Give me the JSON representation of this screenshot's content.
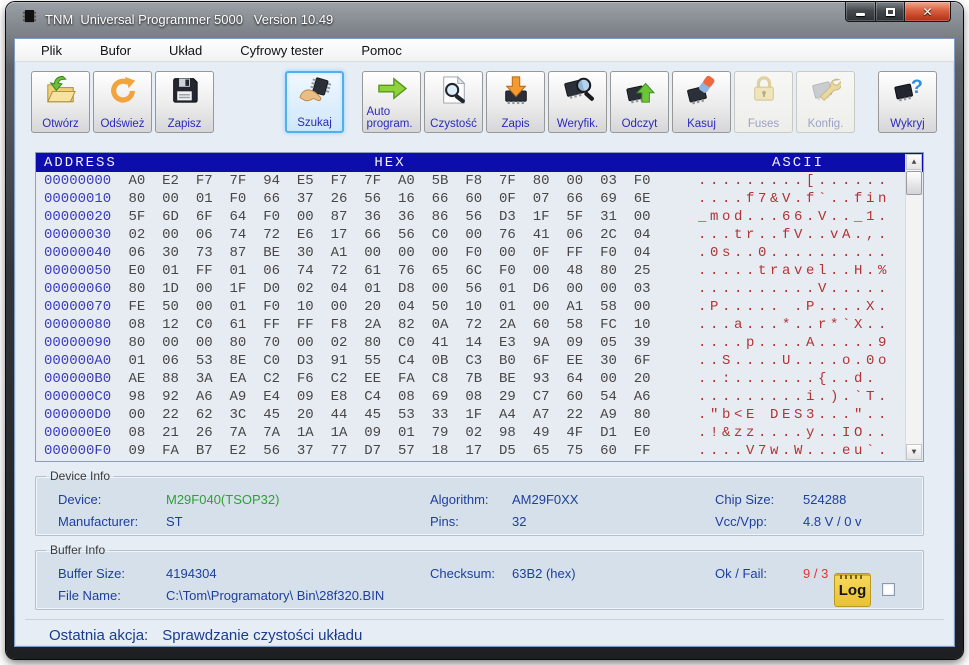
{
  "window": {
    "title": "TNM  Universal Programmer 5000   Version 10.49"
  },
  "menu": {
    "items": [
      "Plik",
      "Bufor",
      "Układ",
      "Cyfrowy tester",
      "Pomoc"
    ]
  },
  "toolbar": {
    "buttons": [
      {
        "label": "Otwórz",
        "state": "normal"
      },
      {
        "label": "Odśwież",
        "state": "normal"
      },
      {
        "label": "Zapisz",
        "state": "normal"
      },
      {
        "label": "Szukaj",
        "state": "active"
      },
      {
        "label": "Auto program.",
        "state": "normal"
      },
      {
        "label": "Czystość",
        "state": "normal"
      },
      {
        "label": "Zapis",
        "state": "normal"
      },
      {
        "label": "Weryfik.",
        "state": "normal"
      },
      {
        "label": "Odczyt",
        "state": "normal"
      },
      {
        "label": "Kasuj",
        "state": "normal"
      },
      {
        "label": "Fuses",
        "state": "disabled"
      },
      {
        "label": "Konfig.",
        "state": "disabled"
      },
      {
        "label": "Wykryj",
        "state": "normal"
      }
    ]
  },
  "hex_view": {
    "headers": {
      "address": "ADDRESS",
      "hex": "HEX",
      "ascii": "ASCII"
    },
    "rows": [
      {
        "address": "00000000",
        "bytes": [
          "A0",
          "E2",
          "F7",
          "7F",
          "94",
          "E5",
          "F7",
          "7F",
          "A0",
          "5B",
          "F8",
          "7F",
          "80",
          "00",
          "03",
          "F0"
        ],
        "ascii": ".........[......"
      },
      {
        "address": "00000010",
        "bytes": [
          "80",
          "00",
          "01",
          "F0",
          "66",
          "37",
          "26",
          "56",
          "16",
          "66",
          "60",
          "0F",
          "07",
          "66",
          "69",
          "6E"
        ],
        "ascii": "....f7&V.f`..fin"
      },
      {
        "address": "00000020",
        "bytes": [
          "5F",
          "6D",
          "6F",
          "64",
          "F0",
          "00",
          "87",
          "36",
          "36",
          "86",
          "56",
          "D3",
          "1F",
          "5F",
          "31",
          "00"
        ],
        "ascii": "_mod...66.V.._1."
      },
      {
        "address": "00000030",
        "bytes": [
          "02",
          "00",
          "06",
          "74",
          "72",
          "E6",
          "17",
          "66",
          "56",
          "C0",
          "00",
          "76",
          "41",
          "06",
          "2C",
          "04"
        ],
        "ascii": "...tr..fV..vA.,."
      },
      {
        "address": "00000040",
        "bytes": [
          "06",
          "30",
          "73",
          "87",
          "BE",
          "30",
          "A1",
          "00",
          "00",
          "00",
          "F0",
          "00",
          "0F",
          "FF",
          "F0",
          "04"
        ],
        "ascii": ".0s..0.........."
      },
      {
        "address": "00000050",
        "bytes": [
          "E0",
          "01",
          "FF",
          "01",
          "06",
          "74",
          "72",
          "61",
          "76",
          "65",
          "6C",
          "F0",
          "00",
          "48",
          "80",
          "25"
        ],
        "ascii": ".....travel..H.%"
      },
      {
        "address": "00000060",
        "bytes": [
          "80",
          "1D",
          "00",
          "1F",
          "D0",
          "02",
          "04",
          "01",
          "D8",
          "00",
          "56",
          "01",
          "D6",
          "00",
          "00",
          "03"
        ],
        "ascii": "..........V....."
      },
      {
        "address": "00000070",
        "bytes": [
          "FE",
          "50",
          "00",
          "01",
          "F0",
          "10",
          "00",
          "20",
          "04",
          "50",
          "10",
          "01",
          "00",
          "A1",
          "58",
          "00"
        ],
        "ascii": ".P..... .P....X."
      },
      {
        "address": "00000080",
        "bytes": [
          "08",
          "12",
          "C0",
          "61",
          "FF",
          "FF",
          "F8",
          "2A",
          "82",
          "0A",
          "72",
          "2A",
          "60",
          "58",
          "FC",
          "10"
        ],
        "ascii": "...a...*..r*`X.."
      },
      {
        "address": "00000090",
        "bytes": [
          "80",
          "00",
          "00",
          "80",
          "70",
          "00",
          "02",
          "80",
          "C0",
          "41",
          "14",
          "E3",
          "9A",
          "09",
          "05",
          "39"
        ],
        "ascii": "....p....A.....9"
      },
      {
        "address": "000000A0",
        "bytes": [
          "01",
          "06",
          "53",
          "8E",
          "C0",
          "D3",
          "91",
          "55",
          "C4",
          "0B",
          "C3",
          "B0",
          "6F",
          "EE",
          "30",
          "6F"
        ],
        "ascii": "..S....U....o.0o"
      },
      {
        "address": "000000B0",
        "bytes": [
          "AE",
          "88",
          "3A",
          "EA",
          "C2",
          "F6",
          "C2",
          "EE",
          "FA",
          "C8",
          "7B",
          "BE",
          "93",
          "64",
          "00",
          "20"
        ],
        "ascii": "..:.......{..d. "
      },
      {
        "address": "000000C0",
        "bytes": [
          "98",
          "92",
          "A6",
          "A9",
          "E4",
          "09",
          "E8",
          "C4",
          "08",
          "69",
          "08",
          "29",
          "C7",
          "60",
          "54",
          "A6"
        ],
        "ascii": ".........i.).`T."
      },
      {
        "address": "000000D0",
        "bytes": [
          "00",
          "22",
          "62",
          "3C",
          "45",
          "20",
          "44",
          "45",
          "53",
          "33",
          "1F",
          "A4",
          "A7",
          "22",
          "A9",
          "80"
        ],
        "ascii": ".\"b<E DES3...\".."
      },
      {
        "address": "000000E0",
        "bytes": [
          "08",
          "21",
          "26",
          "7A",
          "7A",
          "1A",
          "1A",
          "09",
          "01",
          "79",
          "02",
          "98",
          "49",
          "4F",
          "D1",
          "E0"
        ],
        "ascii": ".!&zz....y..IO.."
      },
      {
        "address": "000000F0",
        "bytes": [
          "09",
          "FA",
          "B7",
          "E2",
          "56",
          "37",
          "77",
          "D7",
          "57",
          "18",
          "17",
          "D5",
          "65",
          "75",
          "60",
          "FF"
        ],
        "ascii": "....V7w.W...eu`."
      }
    ]
  },
  "device_info": {
    "title": "Device Info",
    "device_label": "Device:",
    "device_value": "M29F040(TSOP32)",
    "algorithm_label": "Algorithm:",
    "algorithm_value": "AM29F0XX",
    "chip_size_label": "Chip Size:",
    "chip_size_value": "524288",
    "manufacturer_label": "Manufacturer:",
    "manufacturer_value": "ST",
    "pins_label": "Pins:",
    "pins_value": "32",
    "vcc_label": "Vcc/Vpp:",
    "vcc_value": "4.8 V / 0 v"
  },
  "buffer_info": {
    "title": "Buffer Info",
    "buffer_size_label": "Buffer Size:",
    "buffer_size_value": "4194304",
    "checksum_label": "Checksum:",
    "checksum_value": "63B2 (hex)",
    "okfail_label": "Ok / Fail:",
    "okfail_value": "9 / 3",
    "file_name_label": "File Name:",
    "file_name_value": "C:\\Tom\\Programatory\\ Bin\\28f320.BIN",
    "log_label": "Log"
  },
  "status_bar": {
    "label": "Ostatnia akcja:",
    "value": "Sprawdzanie czystości układu"
  },
  "colors": {
    "hex_header_bg": "#0d0dab",
    "address_text": "#3b3bc0",
    "hex_text": "#474747",
    "ascii_text": "#b03434",
    "device_value_green": "#2da136",
    "fail_red": "#e03434",
    "active_button_border": "#54aeea",
    "info_label_navy": "#1d3f9e"
  }
}
